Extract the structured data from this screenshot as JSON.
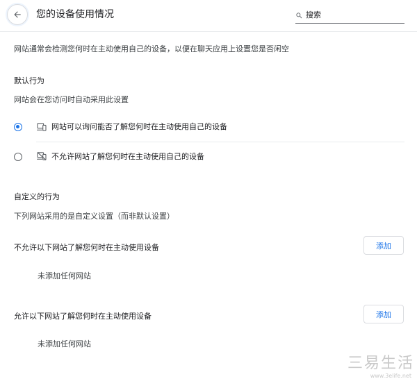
{
  "header": {
    "title": "您的设备使用情况",
    "search_placeholder": "搜索",
    "search_value": ""
  },
  "description": "网站通常会检测您何时在主动使用自己的设备，以便在聊天应用上设置您是否闲空",
  "default_section": {
    "heading": "默认行为",
    "subheading": "网站会在您访问时自动采用此设置",
    "options": [
      {
        "label": "网站可以询问能否了解您何时在主动使用自己的设备",
        "selected": true,
        "icon": "device-active-icon"
      },
      {
        "label": "不允许网站了解您何时在主动使用自己的设备",
        "selected": false,
        "icon": "device-blocked-icon"
      }
    ]
  },
  "custom_section": {
    "heading": "自定义的行为",
    "subheading": "下列网站采用的是自定义设置（而非默认设置）",
    "block_list": {
      "title": "不允许以下网站了解您何时在主动使用设备",
      "add_label": "添加",
      "empty_text": "未添加任何网站"
    },
    "allow_list": {
      "title": "允许以下网站了解您何时在主动使用设备",
      "add_label": "添加",
      "empty_text": "未添加任何网站"
    }
  },
  "watermark": {
    "text": "三易生活",
    "sub": "www.3elife.net"
  },
  "colors": {
    "accent": "#1a73e8",
    "text": "#202124",
    "secondary_text": "#3c4043",
    "divider": "#e8eaed"
  }
}
